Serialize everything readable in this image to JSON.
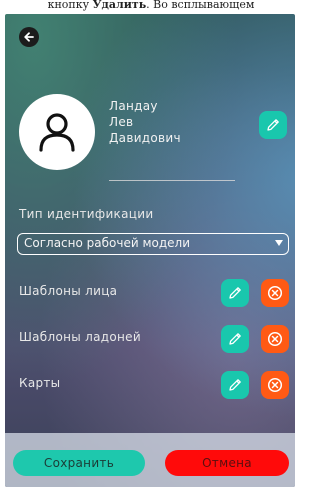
{
  "header": {
    "instruction_prefix": "кнопку",
    "instruction_bold": "Удалить",
    "instruction_suffix": ". Во всплывающем"
  },
  "profile": {
    "last_name": "Ландау",
    "first_name": "Лев",
    "patronymic": "Давидович"
  },
  "identification": {
    "label": "Тип идентификации",
    "selected": "Согласно рабочей модели"
  },
  "templates": [
    {
      "label": "Шаблоны лица"
    },
    {
      "label": "Шаблоны ладоней"
    },
    {
      "label": "Карты"
    }
  ],
  "footer": {
    "save_label": "Сохранить",
    "cancel_label": "Отмена"
  },
  "colors": {
    "accent": "#19c7ad",
    "delete": "#ff5a14",
    "cancel": "#ff0a0a"
  }
}
